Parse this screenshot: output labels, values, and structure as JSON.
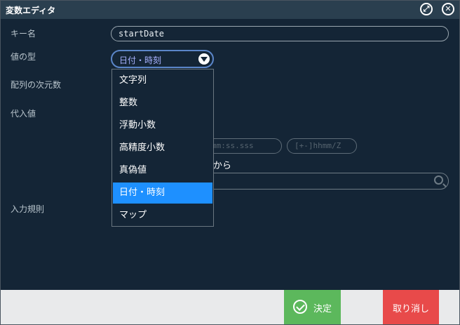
{
  "dialog": {
    "title": "変数エディタ",
    "popout_glyph": "⤢",
    "close_glyph": "✕"
  },
  "form": {
    "key_label": "キー名",
    "key_value": "startDate",
    "type_label": "値の型",
    "type_value": "日付・時刻",
    "array_dim_label": "配列の次元数",
    "default_value_label": "代入値",
    "input_rule_label": "入力規則",
    "time_format_partial": "mm:ss.sss",
    "timezone_format": "[+-]hhmm/Z",
    "kara_partial": "から"
  },
  "type_options": [
    "文字列",
    "整数",
    "浮動小数",
    "高精度小数",
    "真偽値",
    "日付・時刻",
    "マップ"
  ],
  "type_selected_index": 5,
  "footer": {
    "ok_label": "決定",
    "cancel_label": "取り消し"
  },
  "colors": {
    "background": "#142536",
    "titlebar": "#2a3f4f",
    "selected": "#1e90ff",
    "ok": "#5cb85c",
    "cancel": "#e84a4a"
  }
}
